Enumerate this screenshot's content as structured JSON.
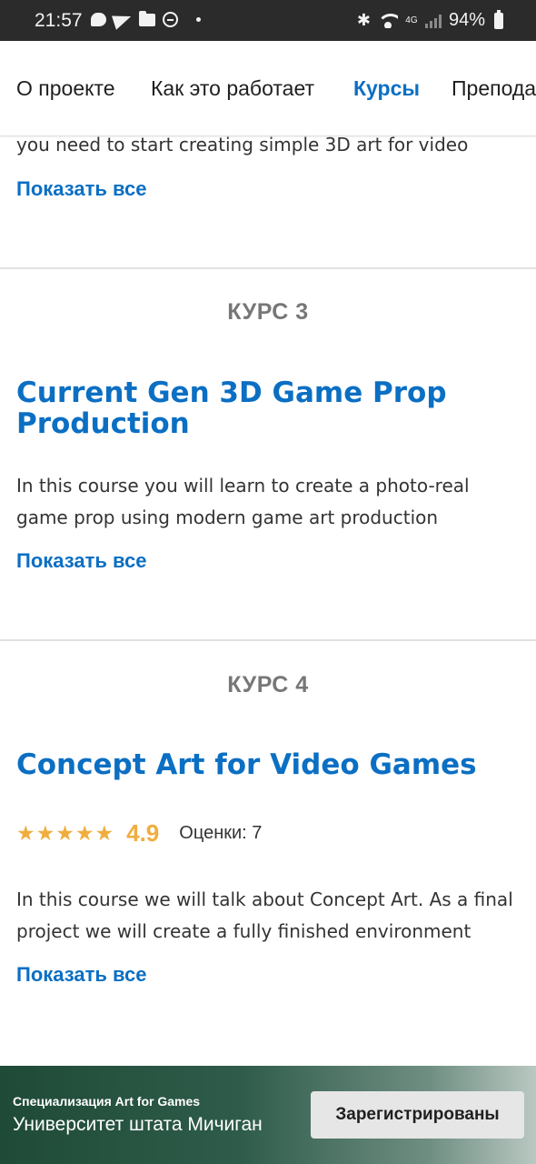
{
  "status_bar": {
    "time": "21:57",
    "network": "4G",
    "battery": "94%"
  },
  "nav": {
    "items": [
      {
        "label": "О проекте",
        "active": false
      },
      {
        "label": "Как это работает",
        "active": false
      },
      {
        "label": "Курсы",
        "active": true
      },
      {
        "label": "Преподаватели",
        "active": false
      }
    ]
  },
  "courses": [
    {
      "description": "you need to start creating simple 3D art for video games",
      "show_all": "Показать все"
    },
    {
      "label": "КУРС 3",
      "title": "Current Gen 3D Game Prop Production",
      "description": "In this course you will learn to create a photo-real game prop using modern game art production techniques. You",
      "show_all": "Показать все"
    },
    {
      "label": "КУРС 4",
      "title": "Concept Art for Video Games",
      "rating": {
        "stars": 5,
        "value": "4.9",
        "count_text": "Оценки: 7"
      },
      "description": "In this course we will talk about Concept Art. As a final project we will create a fully finished environment concept,",
      "show_all": "Показать все"
    }
  ],
  "banner": {
    "subtitle": "Специализация Art for Games",
    "title": "Университет штата Мичиган",
    "button_label": "Зарегистрированы"
  },
  "colors": {
    "accent": "#0b6fc3",
    "star": "#f0ad3e",
    "status_bar": "#2b2b2b"
  }
}
